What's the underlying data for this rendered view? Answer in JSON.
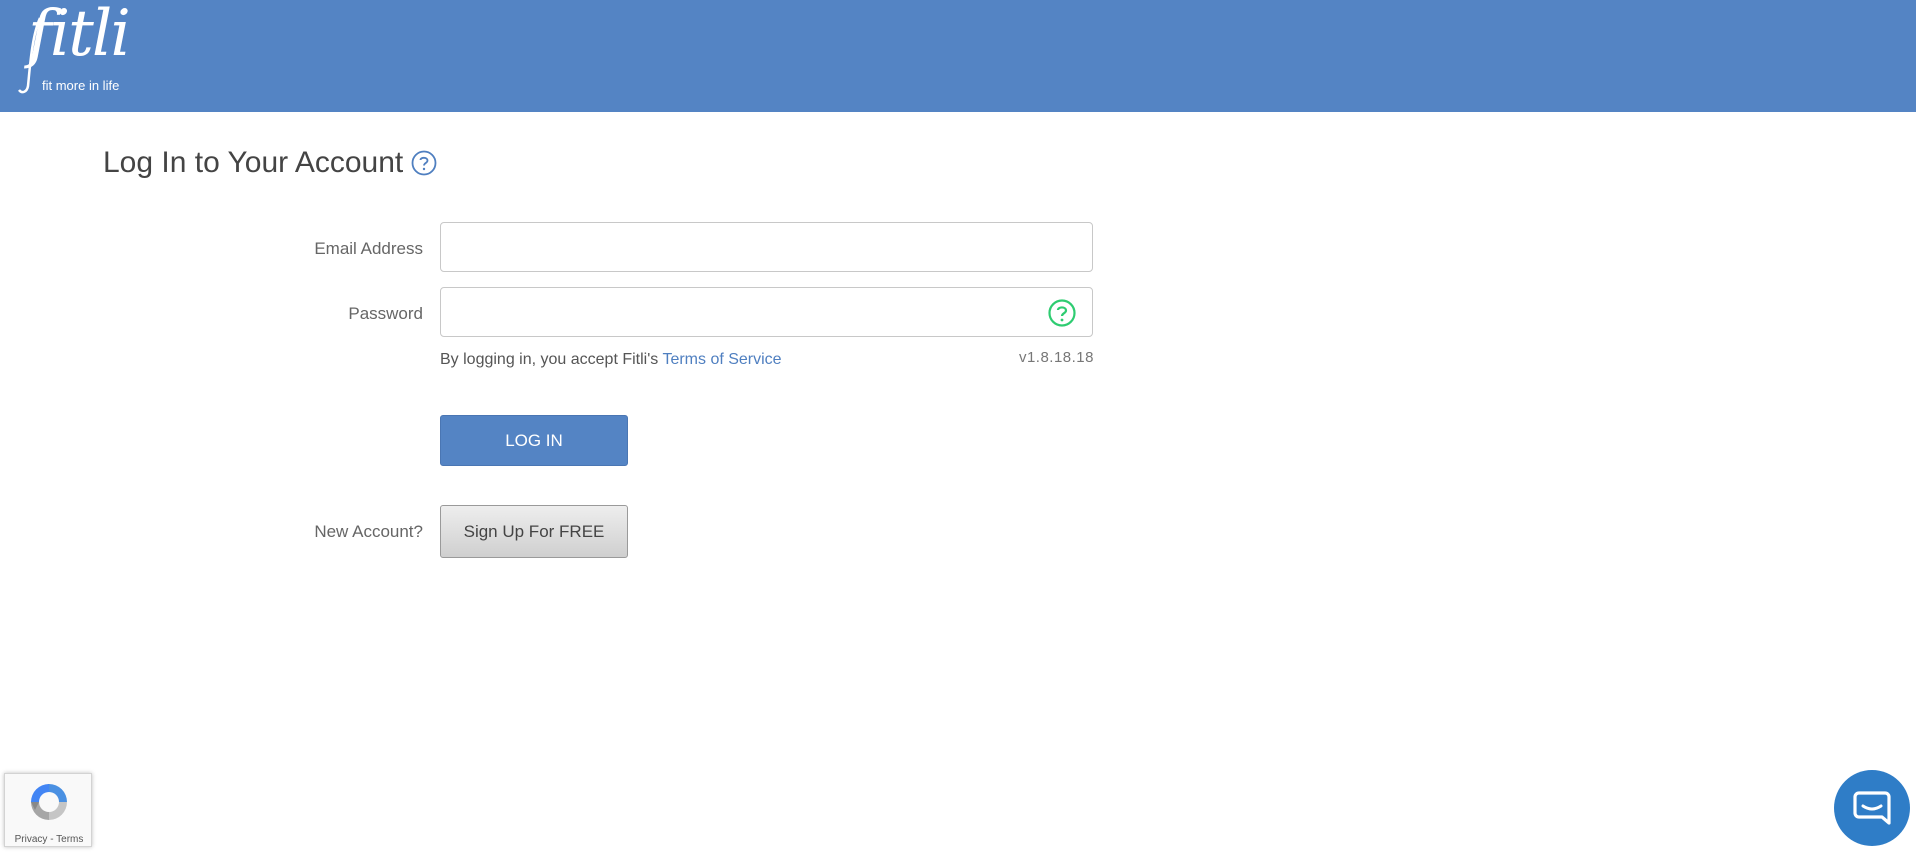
{
  "header": {
    "logo_text": "fitli",
    "logo_tagline": "fit more in life",
    "background_color": "#5484c4"
  },
  "main": {
    "title": "Log In to Your Account",
    "title_help_icon": "question-circle-icon",
    "email": {
      "label": "Email Address",
      "value": "",
      "placeholder": ""
    },
    "password": {
      "label": "Password",
      "value": "",
      "placeholder": "",
      "help_icon": "question-circle-icon"
    },
    "terms": {
      "prefix": "By logging in, you accept Fitli's ",
      "link_text": "Terms of Service"
    },
    "version": "v1.8.18.18",
    "login_button": "LOG IN",
    "new_account_label": "New Account?",
    "signup_button": "Sign Up For FREE"
  },
  "recaptcha": {
    "privacy": "Privacy",
    "separator": " - ",
    "terms": "Terms"
  },
  "chat": {
    "icon": "chat-bubble-icon"
  },
  "colors": {
    "brand_blue": "#5484c4",
    "link_blue": "#4f7fc0",
    "help_green": "#2ecc71",
    "chat_blue": "#2f7dc7"
  }
}
